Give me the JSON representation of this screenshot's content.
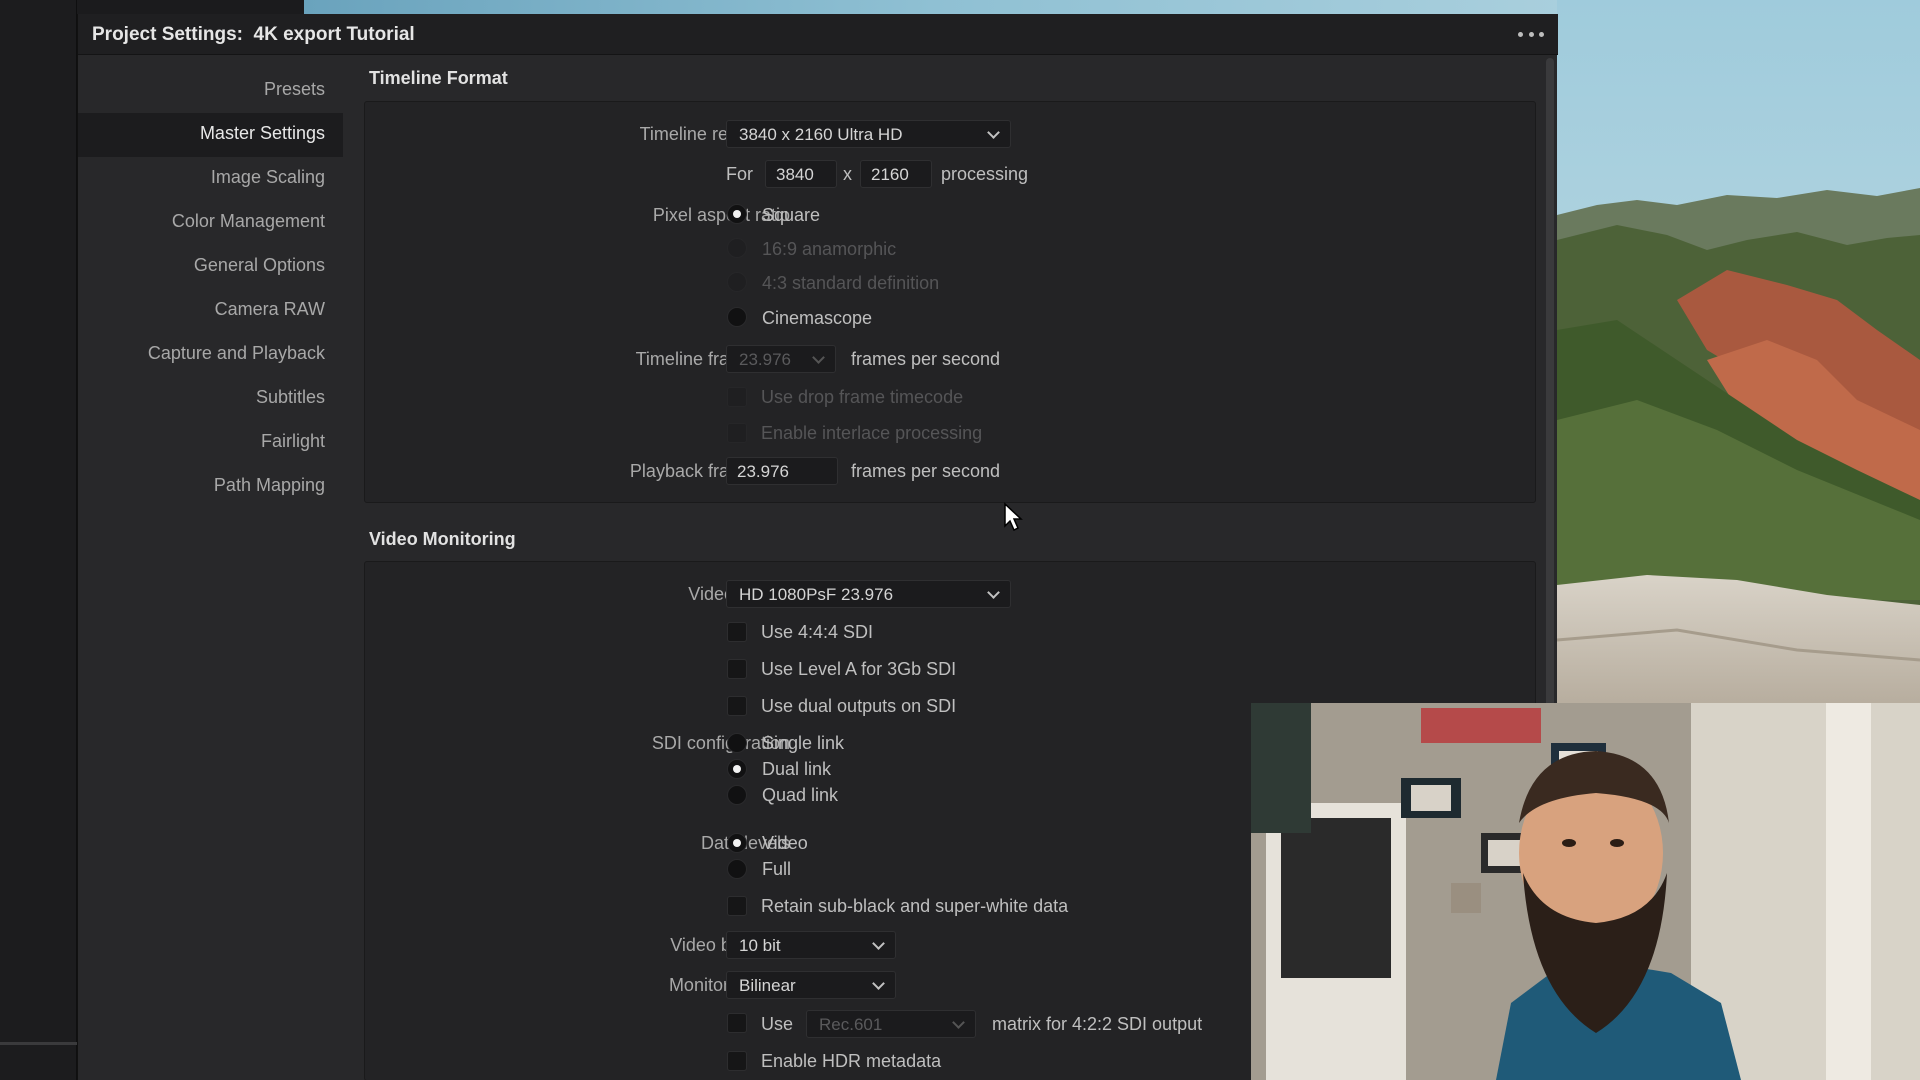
{
  "dialog": {
    "title": "Project Settings:  4K export Tutorial",
    "more_icon": "more-horizontal-icon"
  },
  "nav": {
    "items": [
      {
        "label": "Presets",
        "active": false
      },
      {
        "label": "Master Settings",
        "active": true
      },
      {
        "label": "Image Scaling",
        "active": false
      },
      {
        "label": "Color Management",
        "active": false
      },
      {
        "label": "General Options",
        "active": false
      },
      {
        "label": "Camera RAW",
        "active": false
      },
      {
        "label": "Capture and Playback",
        "active": false
      },
      {
        "label": "Subtitles",
        "active": false
      },
      {
        "label": "Fairlight",
        "active": false
      },
      {
        "label": "Path Mapping",
        "active": false
      }
    ]
  },
  "timeline_format": {
    "title": "Timeline Format",
    "resolution_label": "Timeline resolution",
    "resolution_value": "3840 x 2160 Ultra HD",
    "for_label": "For",
    "width": "3840",
    "x_label": "x",
    "height": "2160",
    "processing_label": "processing",
    "pixel_aspect_label": "Pixel aspect ratio",
    "pixel_aspect_options": [
      {
        "label": "Square",
        "selected": true,
        "enabled": true
      },
      {
        "label": "16:9 anamorphic",
        "selected": false,
        "enabled": false
      },
      {
        "label": "4:3 standard definition",
        "selected": false,
        "enabled": false
      },
      {
        "label": "Cinemascope",
        "selected": false,
        "enabled": true
      }
    ],
    "frame_rate_label": "Timeline frame rate",
    "frame_rate_value": "23.976",
    "fps_label": "frames per second",
    "drop_frame_label": "Use drop frame timecode",
    "interlace_label": "Enable interlace processing",
    "playback_rate_label": "Playback frame rate",
    "playback_rate_value": "23.976",
    "playback_fps_label": "frames per second"
  },
  "video_monitoring": {
    "title": "Video Monitoring",
    "format_label": "Video format",
    "format_value": "HD 1080PsF 23.976",
    "use_444_label": "Use 4:4:4 SDI",
    "use_level_a_label": "Use Level A for 3Gb SDI",
    "dual_outputs_label": "Use dual outputs on SDI",
    "sdi_config_label": "SDI configuration",
    "sdi_options": [
      {
        "label": "Single link",
        "selected": false
      },
      {
        "label": "Dual link",
        "selected": true
      },
      {
        "label": "Quad link",
        "selected": false
      }
    ],
    "data_levels_label": "Data levels",
    "data_levels_options": [
      {
        "label": "Video",
        "selected": true
      },
      {
        "label": "Full",
        "selected": false
      }
    ],
    "retain_label": "Retain sub-black and super-white data",
    "bit_depth_label": "Video bit depth",
    "bit_depth_value": "10 bit",
    "scaling_label": "Monitor scaling",
    "scaling_value": "Bilinear",
    "use_label": "Use",
    "matrix_value": "Rec.601",
    "matrix_suffix": "matrix for 4:2:2 SDI output",
    "hdr_label": "Enable HDR metadata"
  },
  "colors": {
    "dialog_bg": "#28282a",
    "panel_bg": "#232325",
    "accent_text": "#e6e6e6"
  }
}
